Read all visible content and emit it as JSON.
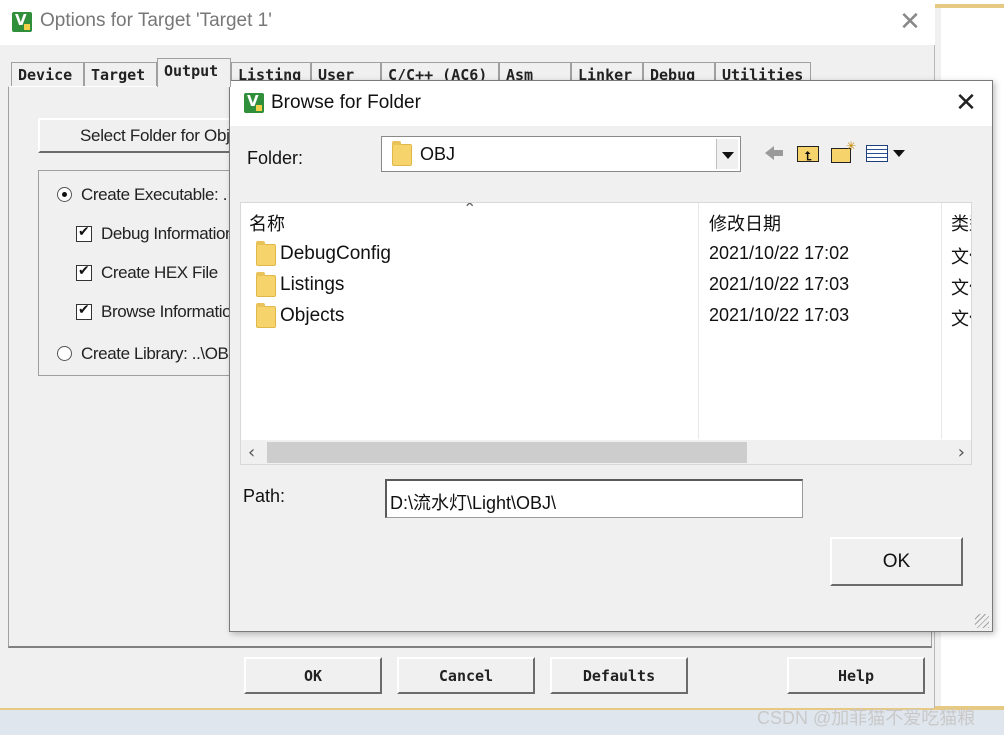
{
  "parent_window": {
    "title": "Options for Target 'Target 1'",
    "close_symbol": "✕",
    "tabs": [
      {
        "label": "Device"
      },
      {
        "label": "Target"
      },
      {
        "label": "Output",
        "active": true
      },
      {
        "label": "Listing"
      },
      {
        "label": "User"
      },
      {
        "label": "C/C++ (AC6)"
      },
      {
        "label": "Asm"
      },
      {
        "label": "Linker"
      },
      {
        "label": "Debug"
      },
      {
        "label": "Utilities"
      }
    ],
    "select_folder_button": "Select Folder for Obje",
    "options": {
      "create_executable": "Create Executable: .",
      "debug_information": "Debug Information",
      "create_hex_file": "Create HEX File",
      "browse_information": "Browse Informatio",
      "create_library": "Create Library: ..\\OB"
    },
    "buttons": {
      "ok": "OK",
      "cancel": "Cancel",
      "defaults": "Defaults",
      "help": "Help"
    }
  },
  "dialog": {
    "title": "Browse for Folder",
    "close_symbol": "✕",
    "folder_label": "Folder:",
    "folder_value": "OBJ",
    "toolbar_icons": [
      "back-icon",
      "up-folder-icon",
      "new-folder-icon",
      "view-menu-icon"
    ],
    "columns": {
      "name": "名称",
      "date": "修改日期",
      "type": "类型"
    },
    "items": [
      {
        "name": "DebugConfig",
        "date": "2021/10/22 17:02",
        "type": "文件夹"
      },
      {
        "name": "Listings",
        "date": "2021/10/22 17:03",
        "type": "文件夹"
      },
      {
        "name": "Objects",
        "date": "2021/10/22 17:03",
        "type": "文件夹"
      }
    ],
    "path_label": "Path:",
    "path_value": "D:\\流水灯\\Light\\OBJ\\",
    "ok_button": "OK"
  },
  "watermark": "CSDN @加菲猫不爱吃猫粮",
  "colors": {
    "folder": "#f6d36b",
    "app_icon": "#2f8f3a",
    "title_bar": "#ffffff",
    "dialog_bg": "#f0f0f0"
  }
}
